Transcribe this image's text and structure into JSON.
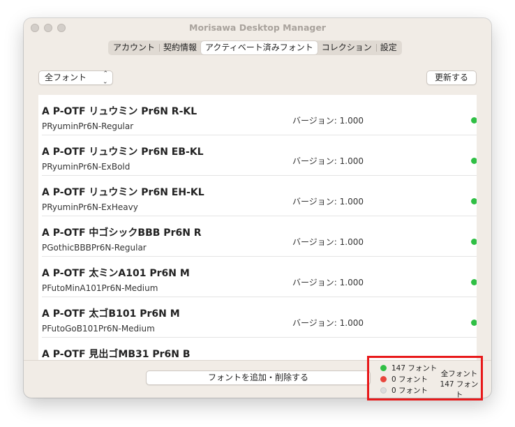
{
  "window": {
    "title": "Morisawa Desktop Manager"
  },
  "tabs": [
    {
      "label": "アカウント",
      "active": false
    },
    {
      "label": "契約情報",
      "active": false
    },
    {
      "label": "アクティベート済みフォント",
      "active": true
    },
    {
      "label": "コレクション",
      "active": false
    },
    {
      "label": "設定",
      "active": false
    }
  ],
  "toolbar": {
    "filter_value": "全フォント",
    "refresh_label": "更新する"
  },
  "fonts": [
    {
      "name": "A P-OTF リュウミン Pr6N R-KL",
      "ps_name": "PRyuminPr6N-Regular",
      "version": "バージョン: 1.000",
      "status": "active"
    },
    {
      "name": "A P-OTF リュウミン Pr6N EB-KL",
      "ps_name": "PRyuminPr6N-ExBold",
      "version": "バージョン: 1.000",
      "status": "active"
    },
    {
      "name": "A P-OTF リュウミン Pr6N EH-KL",
      "ps_name": "PRyuminPr6N-ExHeavy",
      "version": "バージョン: 1.000",
      "status": "active"
    },
    {
      "name": "A P-OTF 中ゴシックBBB Pr6N R",
      "ps_name": "PGothicBBBPr6N-Regular",
      "version": "バージョン: 1.000",
      "status": "active"
    },
    {
      "name": "A P-OTF 太ミンA101 Pr6N M",
      "ps_name": "PFutoMinA101Pr6N-Medium",
      "version": "バージョン: 1.000",
      "status": "active"
    },
    {
      "name": "A P-OTF 太ゴB101 Pr6N M",
      "ps_name": "PFutoGoB101Pr6N-Medium",
      "version": "バージョン: 1.000",
      "status": "active"
    },
    {
      "name": "A P-OTF 見出ゴMB31 Pr6N B",
      "ps_name": "",
      "version": "",
      "status": ""
    }
  ],
  "footer": {
    "add_remove_label": "フォントを追加・削除する",
    "status_counts": [
      {
        "label": "147 フォント",
        "color": "#2fbf44"
      },
      {
        "label": "0 フォント",
        "color": "#e8453c"
      },
      {
        "label": "0 フォント",
        "color": "#dcdcdc"
      }
    ],
    "total_label": "全フォント",
    "total_count": "147 フォント"
  },
  "colors": {
    "active": "#2fbf44",
    "highlight": "#e8191a"
  }
}
